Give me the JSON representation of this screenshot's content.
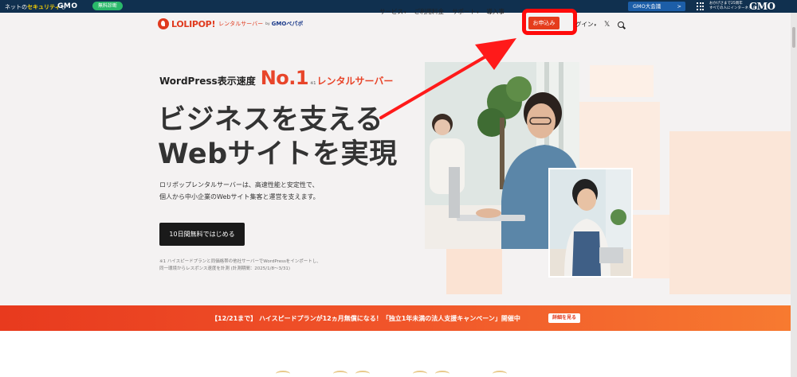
{
  "gmo_bar": {
    "security_prefix": "ネットの",
    "security_highlight": "セキュリティ",
    "security_suffix": "も",
    "gmo_logo": "GMO",
    "free_diagnosis": "無料診断",
    "meeting_label": "GMO大会議",
    "meeting_arrow": ">",
    "thanks_line1": "おかげさまで25周年",
    "thanks_line2": "すべての人にインターネット",
    "gmo_right": "GMO"
  },
  "header": {
    "brand": "LOLIPOP!",
    "brand_sub": "レンタルサーバー",
    "by": "by",
    "company": "GMOペパボ",
    "nav": [
      {
        "label": "サービス",
        "caret": "▾"
      },
      {
        "label": "ご利用料金",
        "caret": ""
      },
      {
        "label": "サポート",
        "caret": "▾"
      },
      {
        "label": "導入事",
        "caret": ""
      }
    ],
    "apply": "お申込み",
    "login": "グイン",
    "login_caret": "▾",
    "x_icon": "𝕏"
  },
  "hero": {
    "kicker_a": "WordPress表示速度",
    "no1": "No.1",
    "note": "※1",
    "kicker_b": "レンタルサーバー",
    "title_line1": "ビジネスを支える",
    "title_line2": "Webサイトを実現",
    "desc_line1": "ロリポップレンタルサーバーは、高速性能と安定性で、",
    "desc_line2": "個人から中小企業のWebサイト集客と運営を支えます。",
    "cta": "10日間無料ではじめる",
    "footnote_line1": "※1 ハイスピードプランと同価格帯の他社サーバーでWordPressをインポートし、",
    "footnote_line2": "同一環境からレスポンス速度を計測 (計測期間：2025/1/8〜3/31)"
  },
  "banner": {
    "text": "【12/21まで】 ハイスピードプランが12ヵ月無償になる！「独立1年未満の法人支援キャンペーン」開催中",
    "details": "詳細を見る"
  },
  "colors": {
    "brand": "#e03a1e",
    "highlight_box": "#ff0b0b",
    "gmo_bar": "#10304f"
  }
}
